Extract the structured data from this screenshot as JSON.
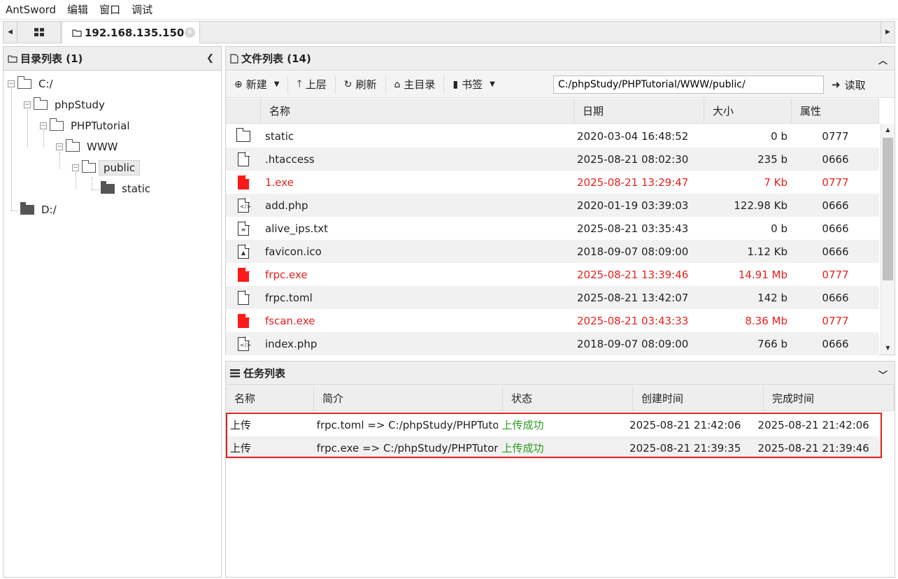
{
  "menubar": {
    "items": [
      "AntSword",
      "编辑",
      "窗口",
      "调试"
    ]
  },
  "tabbar": {
    "active_tab": "192.168.135.150"
  },
  "dir_panel": {
    "title": "目录列表 (1)",
    "tree": {
      "c_drive": "C:/",
      "phpstudy": "phpStudy",
      "phptutorial": "PHPTutorial",
      "www": "WWW",
      "public": "public",
      "static": "static",
      "d_drive": "D:/"
    }
  },
  "file_panel": {
    "title": "文件列表 (14)",
    "toolbar": {
      "new_label": "新建",
      "up_label": "上层",
      "refresh_label": "刷新",
      "home_label": "主目录",
      "bookmark_label": "书签",
      "path_value": "C:/phpStudy/PHPTutorial/WWW/public/",
      "read_label": "读取"
    },
    "columns": {
      "name": "名称",
      "date": "日期",
      "size": "大小",
      "attr": "属性"
    },
    "rows": [
      {
        "icon": "folder-icon",
        "name": "static",
        "date": "2020-03-04 16:48:52",
        "size": "0 b",
        "attr": "0777"
      },
      {
        "icon": "file-icon",
        "name": ".htaccess",
        "date": "2025-08-21 08:02:30",
        "size": "235 b",
        "attr": "0666"
      },
      {
        "icon": "exe-file-icon",
        "name": "1.exe",
        "date": "2025-08-21 13:29:47",
        "size": "7 Kb",
        "attr": "0777"
      },
      {
        "icon": "code-file-icon",
        "name": "add.php",
        "date": "2020-01-19 03:39:03",
        "size": "122.98 Kb",
        "attr": "0666"
      },
      {
        "icon": "text-file-icon",
        "name": "alive_ips.txt",
        "date": "2025-08-21 03:35:43",
        "size": "0 b",
        "attr": "0666"
      },
      {
        "icon": "image-file-icon",
        "name": "favicon.ico",
        "date": "2018-09-07 08:09:00",
        "size": "1.12 Kb",
        "attr": "0666"
      },
      {
        "icon": "exe-file-icon",
        "name": "frpc.exe",
        "date": "2025-08-21 13:39:46",
        "size": "14.91 Mb",
        "attr": "0777"
      },
      {
        "icon": "file-icon",
        "name": "frpc.toml",
        "date": "2025-08-21 13:42:07",
        "size": "142 b",
        "attr": "0666"
      },
      {
        "icon": "exe-file-icon",
        "name": "fscan.exe",
        "date": "2025-08-21 03:43:33",
        "size": "8.36 Mb",
        "attr": "0777"
      },
      {
        "icon": "code-file-icon",
        "name": "index.php",
        "date": "2018-09-07 08:09:00",
        "size": "766 b",
        "attr": "0666"
      }
    ],
    "colors": {
      "exe_text": "#e8211c",
      "exe_icon": "#ff1a1a"
    }
  },
  "task_panel": {
    "title": "任务列表",
    "columns": {
      "name": "名称",
      "desc": "简介",
      "status": "状态",
      "created": "创建时间",
      "done": "完成时间"
    },
    "rows": [
      {
        "name": "上传",
        "desc": "frpc.toml => C:/phpStudy/PHPTutorial/WWW/public/frpc.toml",
        "status": "上传成功",
        "created": "2025-08-21 21:42:06",
        "done": "2025-08-21 21:42:06"
      },
      {
        "name": "上传",
        "desc": "frpc.exe => C:/phpStudy/PHPTutorial/WWW/public/frpc.exe",
        "status": "上传成功",
        "created": "2025-08-21 21:39:35",
        "done": "2025-08-21 21:39:46"
      }
    ],
    "colors": {
      "status_success": "#2c9a1e",
      "highlight": "#e02020"
    }
  }
}
